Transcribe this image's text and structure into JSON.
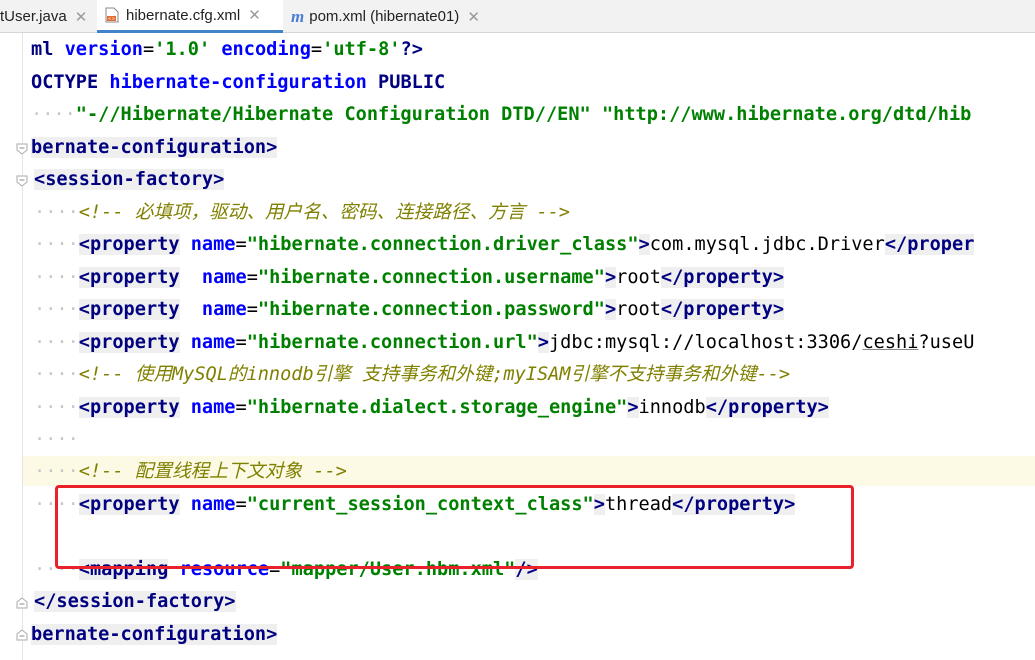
{
  "tabs": [
    {
      "label": "tUser.java",
      "active": false,
      "icon": "java-file-icon"
    },
    {
      "label": "hibernate.cfg.xml",
      "active": true,
      "icon": "xml-file-icon"
    },
    {
      "label": "pom.xml (hibernate01)",
      "active": false,
      "icon": "maven-icon"
    }
  ],
  "code": {
    "l1": {
      "a": "ml ",
      "b": "version",
      "c": "=",
      "d": "'1.0'",
      "e": " ",
      "f": "encoding",
      "g": "=",
      "h": "'utf-8'",
      "i": "?>"
    },
    "l2": {
      "a": "OCTYPE ",
      "b": "hibernate-configuration",
      "c": " PUBLIC"
    },
    "l3": {
      "ws": "····",
      "a": "\"-//Hibernate/Hibernate Configuration DTD//EN\"",
      "b": " ",
      "c": "\"http://www.hibernate.org/dtd/hib"
    },
    "l4": {
      "a": "bernate-configuration>"
    },
    "l5": {
      "a": "<session-factory>"
    },
    "l6": {
      "ws": "····",
      "a": "<!-- 必填项，驱动、用户名、密码、连接路径、方言 -->"
    },
    "l7": {
      "ws": "····",
      "a": "<property",
      "b": " name",
      "c": "=",
      "d": "\"hibernate.connection.driver_class\"",
      "e": ">",
      "f": "com.mysql.jdbc.Driver",
      "g": "</proper"
    },
    "l8": {
      "ws": "····",
      "a": "<property",
      "b": "  name",
      "c": "=",
      "d": "\"hibernate.connection.username\"",
      "e": ">",
      "f": "root",
      "g": "</property>"
    },
    "l9": {
      "ws": "····",
      "a": "<property",
      "b": "  name",
      "c": "=",
      "d": "\"hibernate.connection.password\"",
      "e": ">",
      "f": "root",
      "g": "</property>"
    },
    "l10": {
      "ws": "····",
      "a": "<property",
      "b": " name",
      "c": "=",
      "d": "\"hibernate.connection.url\"",
      "e": ">",
      "f1": "jdbc:mysql://localhost:3306/",
      "f2": "ceshi",
      "f3": "?useU"
    },
    "l11": {
      "ws": "····",
      "a": "<!-- 使用MySQL的innodb引擎 支持事务和外键;myISAM引擎不支持事务和外键-->"
    },
    "l12": {
      "ws": "····",
      "a": "<property",
      "b": " name",
      "c": "=",
      "d": "\"hibernate.dialect.storage_engine\"",
      "e": ">",
      "f": "innodb",
      "g": "</property>"
    },
    "l13": {
      "ws": "····"
    },
    "l14": {
      "ws": "····",
      "a": "<!-- 配置线程上下文对象 -->"
    },
    "l15": {
      "ws": "····",
      "a": "<property",
      "b": " name",
      "c": "=",
      "d": "\"current_session_context_class\"",
      "e": ">",
      "f": "thread",
      "g": "</property>"
    },
    "l17": {
      "ws": "····",
      "a": "<mapping",
      "b": " resource",
      "c": "=",
      "d": "\"mapper/User.hbm.xml\"",
      "e": "/>"
    },
    "l18": {
      "a": "</session-factory>"
    },
    "l19": {
      "a": "bernate-configuration>"
    }
  },
  "colors": {
    "highlight_box": "#e8212a",
    "tab_underline": "#4083c9"
  }
}
